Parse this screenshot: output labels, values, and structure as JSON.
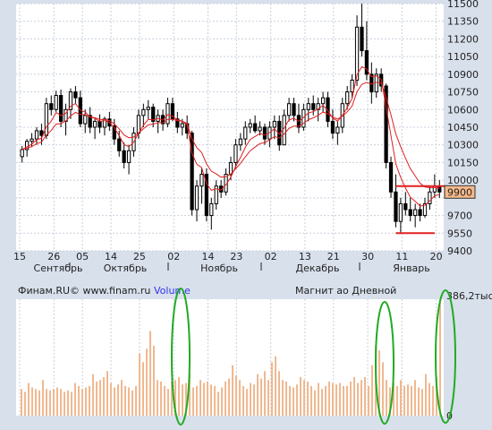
{
  "chart_data": [
    {
      "type": "candlestick",
      "ylim": [
        9400,
        11500
      ],
      "y_ticks": [
        11500,
        11350,
        11200,
        11050,
        10900,
        10750,
        10600,
        10450,
        10300,
        10150,
        10000,
        9850,
        9700,
        9550,
        9400
      ],
      "y_tick_labels": [
        "11500",
        "11350",
        "11200",
        "11050",
        "10900",
        "10750",
        "10600",
        "10450",
        "10300",
        "10150",
        "10000",
        "",
        "9700",
        "9550",
        "9400"
      ],
      "x_tick_labels": [
        "15",
        "26",
        "05",
        "14",
        "25",
        "02",
        "14",
        "23",
        "02",
        "13",
        "21",
        "30",
        "11",
        "20"
      ],
      "month_labels": [
        "Сентябрь",
        "Октябрь",
        "Ноябрь",
        "Декабрь",
        "Январь"
      ],
      "last_price_label": "9900",
      "ohlc": [
        [
          10200,
          10290,
          10150,
          10260
        ],
        [
          10260,
          10350,
          10200,
          10330
        ],
        [
          10330,
          10400,
          10280,
          10350
        ],
        [
          10350,
          10450,
          10300,
          10420
        ],
        [
          10420,
          10480,
          10300,
          10380
        ],
        [
          10380,
          10700,
          10350,
          10650
        ],
        [
          10650,
          10720,
          10550,
          10600
        ],
        [
          10600,
          10760,
          10580,
          10720
        ],
        [
          10720,
          10770,
          10450,
          10500
        ],
        [
          10500,
          10650,
          10380,
          10600
        ],
        [
          10600,
          10780,
          10520,
          10750
        ],
        [
          10750,
          10800,
          10650,
          10700
        ],
        [
          10700,
          10760,
          10450,
          10480
        ],
        [
          10480,
          10600,
          10400,
          10550
        ],
        [
          10550,
          10620,
          10400,
          10450
        ],
        [
          10450,
          10520,
          10350,
          10500
        ],
        [
          10500,
          10560,
          10400,
          10450
        ],
        [
          10450,
          10540,
          10380,
          10520
        ],
        [
          10520,
          10580,
          10420,
          10460
        ],
        [
          10460,
          10520,
          10300,
          10350
        ],
        [
          10350,
          10420,
          10200,
          10250
        ],
        [
          10250,
          10320,
          10100,
          10150
        ],
        [
          10150,
          10300,
          10050,
          10250
        ],
        [
          10250,
          10450,
          10200,
          10400
        ],
        [
          10400,
          10600,
          10350,
          10550
        ],
        [
          10550,
          10650,
          10450,
          10600
        ],
        [
          10600,
          10680,
          10520,
          10620
        ],
        [
          10620,
          10650,
          10450,
          10500
        ],
        [
          10500,
          10600,
          10400,
          10550
        ],
        [
          10550,
          10600,
          10420,
          10480
        ],
        [
          10480,
          10700,
          10450,
          10650
        ],
        [
          10650,
          10700,
          10500,
          10520
        ],
        [
          10520,
          10580,
          10400,
          10450
        ],
        [
          10450,
          10520,
          10380,
          10480
        ],
        [
          10480,
          10550,
          10350,
          10400
        ],
        [
          10400,
          10420,
          9700,
          9750
        ],
        [
          9750,
          10000,
          9650,
          9950
        ],
        [
          9950,
          10100,
          9800,
          10050
        ],
        [
          10050,
          10100,
          9650,
          9700
        ],
        [
          9700,
          9850,
          9580,
          9800
        ],
        [
          9800,
          10000,
          9750,
          9950
        ],
        [
          9950,
          10000,
          9850,
          9900
        ],
        [
          9900,
          10100,
          9870,
          10050
        ],
        [
          10050,
          10200,
          10000,
          10150
        ],
        [
          10150,
          10350,
          10100,
          10300
        ],
        [
          10300,
          10400,
          10250,
          10350
        ],
        [
          10350,
          10500,
          10300,
          10450
        ],
        [
          10450,
          10520,
          10400,
          10480
        ],
        [
          10480,
          10550,
          10400,
          10420
        ],
        [
          10420,
          10500,
          10380,
          10450
        ],
        [
          10450,
          10480,
          10300,
          10350
        ],
        [
          10350,
          10500,
          10280,
          10450
        ],
        [
          10450,
          10550,
          10350,
          10500
        ],
        [
          10500,
          10550,
          10250,
          10300
        ],
        [
          10300,
          10600,
          10300,
          10550
        ],
        [
          10550,
          10700,
          10500,
          10650
        ],
        [
          10650,
          10700,
          10500,
          10550
        ],
        [
          10550,
          10650,
          10400,
          10450
        ],
        [
          10450,
          10650,
          10420,
          10600
        ],
        [
          10600,
          10700,
          10500,
          10650
        ],
        [
          10650,
          10720,
          10550,
          10600
        ],
        [
          10600,
          10700,
          10500,
          10650
        ],
        [
          10650,
          10750,
          10580,
          10700
        ],
        [
          10700,
          10750,
          10450,
          10500
        ],
        [
          10500,
          10600,
          10350,
          10400
        ],
        [
          10400,
          10500,
          10300,
          10450
        ],
        [
          10450,
          10700,
          10400,
          10650
        ],
        [
          10650,
          10800,
          10600,
          10750
        ],
        [
          10750,
          10900,
          10700,
          10850
        ],
        [
          10850,
          11400,
          10800,
          11300
        ],
        [
          11300,
          11500,
          11050,
          11100
        ],
        [
          11100,
          11350,
          10850,
          10900
        ],
        [
          10900,
          11000,
          10650,
          10750
        ],
        [
          10750,
          10950,
          10700,
          10900
        ],
        [
          10900,
          10950,
          10750,
          10800
        ],
        [
          10800,
          10820,
          10100,
          10150
        ],
        [
          10150,
          10200,
          9850,
          9900
        ],
        [
          9900,
          10050,
          9600,
          9650
        ],
        [
          9650,
          9850,
          9550,
          9800
        ],
        [
          9800,
          9900,
          9700,
          9750
        ],
        [
          9750,
          9850,
          9650,
          9700
        ],
        [
          9700,
          9800,
          9600,
          9750
        ],
        [
          9750,
          9800,
          9650,
          9700
        ],
        [
          9700,
          9850,
          9680,
          9800
        ],
        [
          9800,
          9950,
          9750,
          9900
        ],
        [
          9900,
          10050,
          9850,
          9950
        ],
        [
          9950,
          10000,
          9850,
          9900
        ]
      ],
      "series": []
    },
    {
      "type": "bar",
      "ylim": [
        0,
        386.2
      ],
      "y_tick_labels": [
        "386,2тыс",
        "0"
      ],
      "values": [
        90,
        80,
        110,
        95,
        90,
        85,
        120,
        90,
        85,
        90,
        95,
        90,
        80,
        85,
        80,
        110,
        100,
        90,
        95,
        100,
        140,
        115,
        120,
        130,
        150,
        110,
        95,
        105,
        120,
        100,
        95,
        85,
        100,
        210,
        180,
        225,
        285,
        235,
        120,
        115,
        100,
        90,
        115,
        120,
        130,
        105,
        110,
        140,
        95,
        100,
        120,
        110,
        115,
        105,
        100,
        80,
        95,
        115,
        125,
        170,
        135,
        120,
        100,
        90,
        110,
        105,
        140,
        125,
        150,
        120,
        180,
        200,
        150,
        120,
        115,
        100,
        95,
        105,
        130,
        120,
        115,
        100,
        85,
        110,
        90,
        100,
        115,
        110,
        105,
        110,
        100,
        100,
        115,
        130,
        110,
        120,
        130,
        100,
        170,
        235,
        220,
        180,
        120,
        95,
        110,
        100,
        120,
        100,
        105,
        100,
        120,
        95,
        90,
        140,
        110,
        100,
        130,
        386
      ]
    }
  ],
  "header": {
    "source": "Финам.RU©  www.finam.ru",
    "volume_label": "Volume",
    "instrument": "Магнит ао Дневной"
  },
  "colors": {
    "background": "#d8e0ec",
    "plot_bg": "#ffffff",
    "grid": "#c8d0dc",
    "candle": "#000000",
    "ma": "#e02020",
    "volume": "#f0b890",
    "highlight_line": "#e02020",
    "price_tag_bg": "#f5b888",
    "annotation_ellipse": "#22aa22"
  }
}
